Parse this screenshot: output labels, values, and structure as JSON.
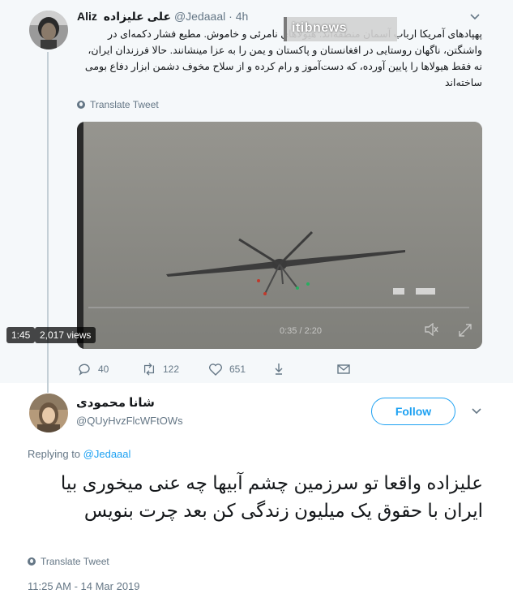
{
  "parent_tweet": {
    "display_name": "Aliz",
    "display_name_rtl": "علی علیزاده",
    "handle": "@Jedaaal",
    "separator": "·",
    "time": "4h",
    "text": "پهپادهای آمریکا ارباب آسمان منطقه‌اند. هیولاهای نامرئی و خاموش. مطیع فشار دکمه‌ای در واشنگتن، ناگهان روستایی در افغانستان و پاکستان و یمن را به عزا مینشانند. حالا فرزندان ایران، نه فقط هیولاها را پایین آورده، که دست‌آموز و رام کرده و از سلاح مخوف دشمن ابزار دفاع بومی ساخته‌اند",
    "translate_label": "Translate Tweet",
    "media": {
      "watermark": "itibnews",
      "duration": "1:45",
      "views": "2,017 views",
      "player_time": "0:35 / 2:20",
      "volume_icon": "volume-mute-icon",
      "fullscreen_icon": "fullscreen-icon"
    },
    "actions": {
      "reply_count": "40",
      "retweet_count": "122",
      "like_count": "651",
      "share_icon": "download-arrow-icon",
      "dm_icon": "envelope-icon"
    }
  },
  "reply_tweet": {
    "display_name": "شانا محمودی",
    "handle": "@QUyHvzFlcWFtOWs",
    "follow_label": "Follow",
    "replying_prefix": "Replying to",
    "replying_to": "@Jedaaal",
    "text": "علیزاده واقعا تو سرزمین چشم آبیها چه عنی میخوری بیا ایران با حقوق یک میلیون زندگی کن بعد چرت بنویس",
    "translate_label": "Translate Tweet",
    "timestamp": "11:25 AM - 14 Mar 2019"
  },
  "colors": {
    "accent": "#1da1f2",
    "muted": "#657786",
    "parent_bg": "#f5f8fa",
    "text": "#14171a"
  }
}
